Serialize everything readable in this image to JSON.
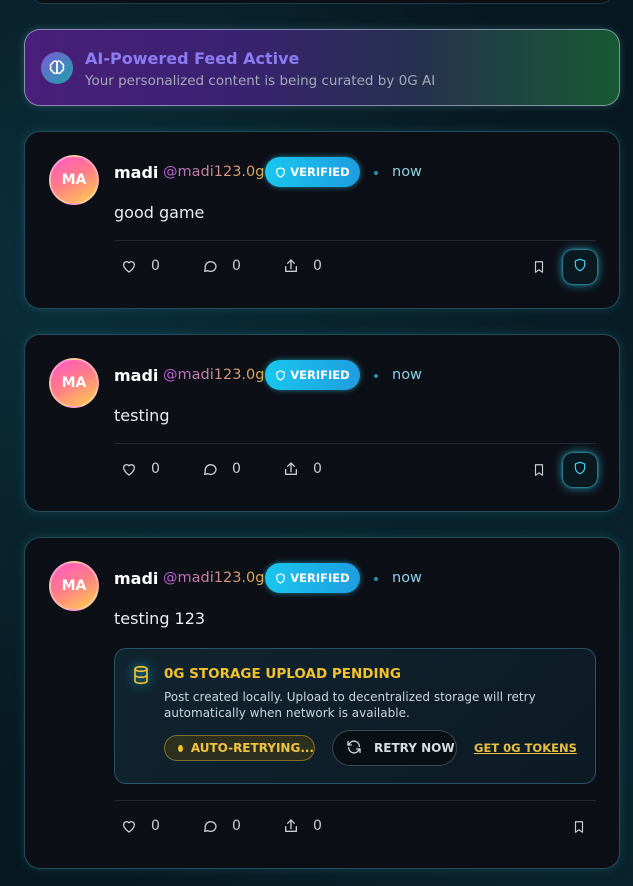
{
  "banner": {
    "title": "AI-Powered Feed Active",
    "subtitle": "Your personalized content is being curated by 0G AI",
    "icon": "brain-icon"
  },
  "posts": [
    {
      "avatar_initials": "MA",
      "author": "madi",
      "handle": "@madi123.0g",
      "badge": "VERIFIED",
      "time": "now",
      "content": "good game",
      "likes": "0",
      "comments": "0",
      "shares": "0"
    },
    {
      "avatar_initials": "MA",
      "author": "madi",
      "handle": "@madi123.0g",
      "badge": "VERIFIED",
      "time": "now",
      "content": "testing",
      "likes": "0",
      "comments": "0",
      "shares": "0"
    },
    {
      "avatar_initials": "MA",
      "author": "madi",
      "handle": "@madi123.0g",
      "badge": "VERIFIED",
      "time": "now",
      "content": "testing 123",
      "likes": "0",
      "comments": "0",
      "shares": "0",
      "storage": {
        "title": "0G STORAGE UPLOAD PENDING",
        "description": "Post created locally. Upload to decentralized storage will retry automatically when network is available.",
        "status": "AUTO-RETRYING...",
        "retry_label": "RETRY NOW",
        "tokens_label": "GET 0G TOKENS"
      }
    }
  ],
  "colors": {
    "accent_cyan": "#19c6ee",
    "warning_yellow": "#f2c22f",
    "banner_title": "#8b7cf2"
  }
}
